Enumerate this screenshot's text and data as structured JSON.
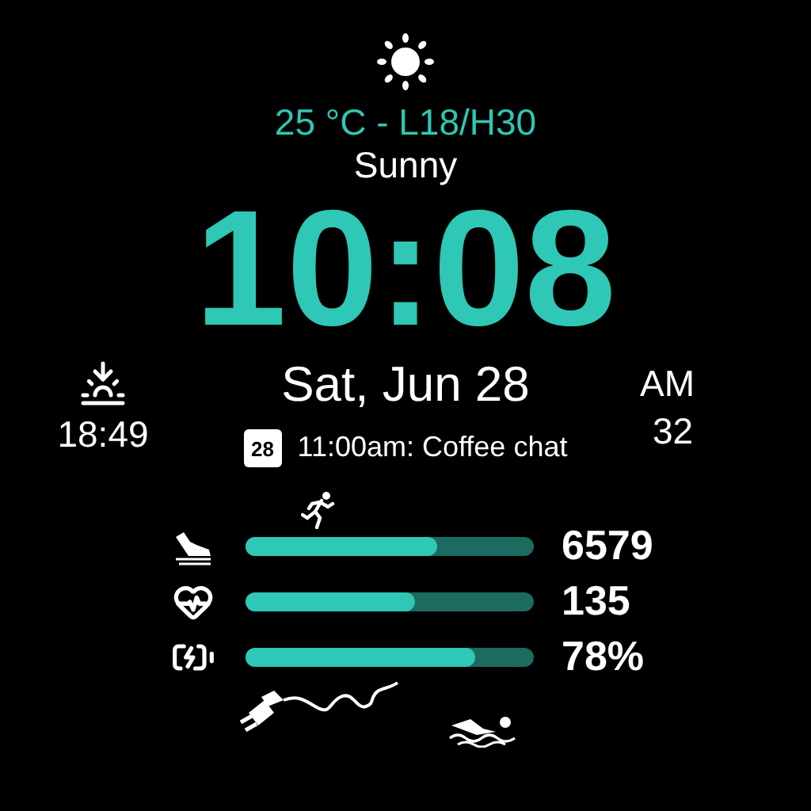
{
  "weather": {
    "temperature": "25 °C - L18/H30",
    "condition": "Sunny"
  },
  "time": "10:08",
  "date": "Sat, Jun 28",
  "sunset": "18:49",
  "am_pm": "AM",
  "right_complication": "32",
  "event": {
    "day": "28",
    "text": "11:00am: Coffee chat"
  },
  "metrics": [
    {
      "kind": "steps",
      "value": "6579",
      "level": 0.67
    },
    {
      "kind": "heart",
      "value": "135",
      "level": 0.59
    },
    {
      "kind": "battery",
      "value": "78%",
      "level": 0.8
    }
  ]
}
